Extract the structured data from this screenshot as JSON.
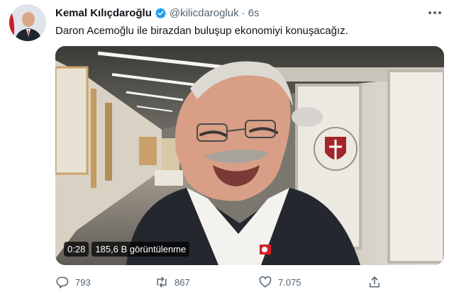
{
  "tweet": {
    "author": {
      "name": "Kemal Kılıçdaroğlu",
      "handle": "@kilicdarogluk",
      "separator": "·",
      "time": "6s"
    },
    "text": "Daron Acemoğlu ile birazdan buluşup ekonomiyi konuşacağız.",
    "video": {
      "duration": "0:28",
      "views": "185,6 B görüntülenme"
    },
    "actions": {
      "reply_count": "793",
      "retweet_count": "867",
      "like_count": "7.075"
    }
  },
  "colors": {
    "verified": "#1d9bf0",
    "muted_text": "#536471",
    "primary_text": "#0f1419"
  },
  "icons": [
    "verified-badge-icon",
    "more-options-icon",
    "reply-icon",
    "retweet-icon",
    "like-icon",
    "share-icon"
  ]
}
